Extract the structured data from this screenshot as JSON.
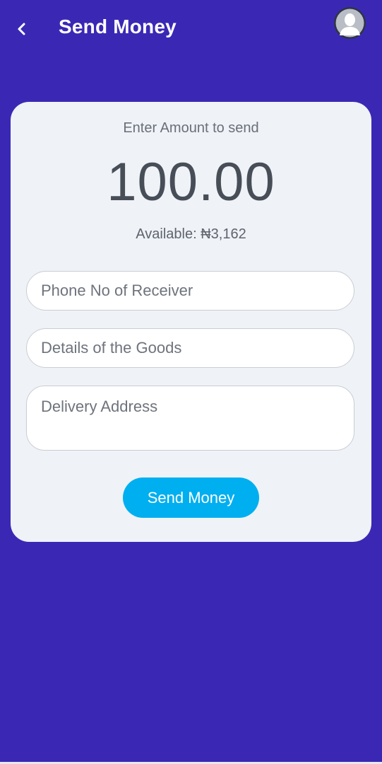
{
  "header": {
    "title": "Send Money",
    "back_icon": "chevron-left-icon",
    "avatar_icon": "user-avatar-icon"
  },
  "amount": {
    "label": "Enter Amount to send",
    "value": "100.00",
    "available": "Available: ₦3,162"
  },
  "form": {
    "phone_placeholder": "Phone No of Receiver",
    "goods_placeholder": "Details of the Goods",
    "address_placeholder": "Delivery Address",
    "submit_label": "Send Money"
  },
  "colors": {
    "background": "#3a28b5",
    "card": "#eff2f7",
    "button": "#00aff0"
  }
}
